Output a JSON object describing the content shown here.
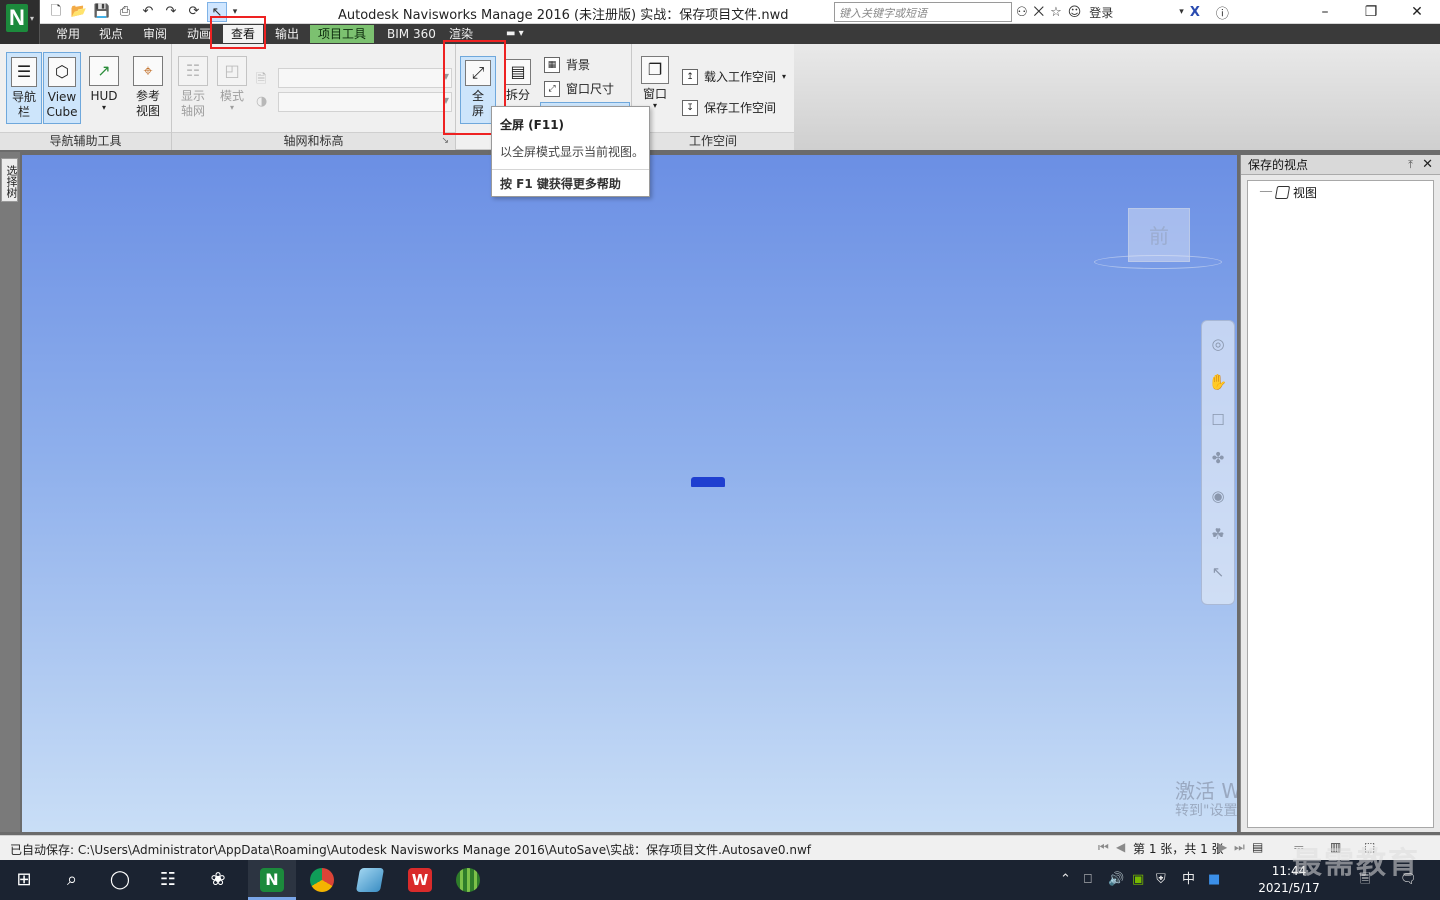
{
  "window": {
    "title": "Autodesk Navisworks Manage 2016 (未注册版)    实战：保存项目文件.nwd",
    "search_placeholder": "键入关键字或短语",
    "login": "登录"
  },
  "menu_tabs": [
    {
      "label": "常用"
    },
    {
      "label": "视点"
    },
    {
      "label": "审阅"
    },
    {
      "label": "动画"
    },
    {
      "label": "查看"
    },
    {
      "label": "输出"
    },
    {
      "label": "项目工具"
    },
    {
      "label": "BIM 360"
    },
    {
      "label": "渲染"
    }
  ],
  "ribbon": {
    "nav_panel": {
      "title": "导航辅助工具",
      "btn_navbar": "导航\n栏",
      "btn_viewcube": "View\nCube",
      "btn_hud": "HUD",
      "btn_ref": "参考\n视图"
    },
    "grid_panel": {
      "title": "轴网和标高",
      "btn_showgrid": "显示\n轴网",
      "btn_mode": "模式"
    },
    "scene_panel": {
      "btn_fullscreen": "全\n屏",
      "btn_split": "拆分",
      "btn_background": "背景",
      "btn_window_size": "窗口尺寸"
    },
    "workspace_panel": {
      "title": "工作空间",
      "btn_window": "窗口",
      "btn_load_ws": "载入工作空间",
      "btn_save_ws": "保存工作空间"
    }
  },
  "tooltip": {
    "title": "全屏 (F11)",
    "description": "以全屏模式显示当前视图。",
    "help": "按 F1 键获得更多帮助"
  },
  "left_tab": "选择树",
  "viewcube_label": "前",
  "saved_viewpoints": {
    "title": "保存的视点",
    "items": [
      {
        "label": "视图"
      }
    ]
  },
  "watermark": {
    "line1": "激活 Windows",
    "line2": "转到\"设置\"以激活 Windows。"
  },
  "statusbar": {
    "autosave": "已自动保存: C:\\Users\\Administrator\\AppData\\Roaming\\Autodesk Navisworks Manage 2016\\AutoSave\\实战：保存项目文件.Autosave0.nwf",
    "pages": "第 1 张，共 1 张"
  },
  "taskbar": {
    "time": "11:44",
    "date": "2021/5/17",
    "ime": "中"
  },
  "brand_watermark": "最需教育"
}
